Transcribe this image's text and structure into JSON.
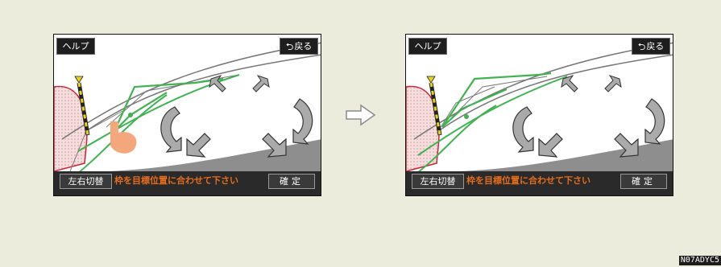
{
  "screens": [
    {
      "help_label": "ヘルプ",
      "back_icon": "return-arrow-icon",
      "back_label": "戻る",
      "switch_label": "左右切替",
      "instruction": "枠を目標位置に合わせて下さい",
      "confirm_label": "確定"
    },
    {
      "help_label": "ヘルプ",
      "back_icon": "return-arrow-icon",
      "back_label": "戻る",
      "switch_label": "左右切替",
      "instruction": "枠を目標位置に合わせて下さい",
      "confirm_label": "確定"
    }
  ],
  "flow_arrow_icon": "right-arrow-icon",
  "figure_code": "N07ADYC5",
  "colors": {
    "guide_line": "#3fb34f",
    "instruction_text": "#e66d1a",
    "touch_marker": "#f3a77a",
    "pole_yellow": "#e8d21c"
  }
}
